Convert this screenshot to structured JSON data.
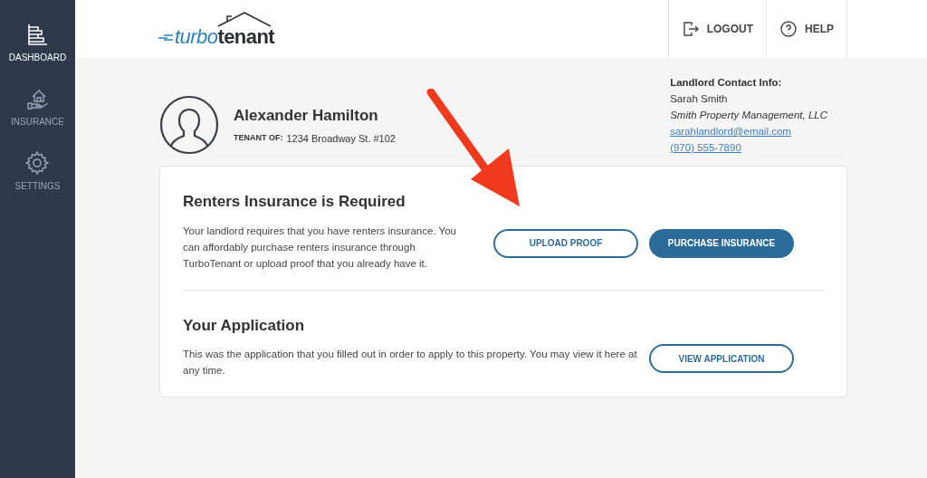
{
  "sidebar": {
    "items": [
      {
        "label": "DASHBOARD",
        "selected": true
      },
      {
        "label": "INSURANCE",
        "selected": false
      },
      {
        "label": "SETTINGS",
        "selected": false
      }
    ]
  },
  "header": {
    "logo": {
      "accent": "turbo",
      "rest": "tenant"
    },
    "actions": [
      {
        "label": "LOGOUT"
      },
      {
        "label": "HELP"
      }
    ]
  },
  "tenant": {
    "name": "Alexander Hamilton",
    "label": "TENANT OF:",
    "address": "1234 Broadway St. #102"
  },
  "landlord": {
    "heading": "Landlord Contact Info:",
    "name": "Sarah Smith",
    "company": "Smith Property Management, LLC",
    "email": "sarahlandlord@email.com",
    "phone": "(970) 555-7890"
  },
  "sections": [
    {
      "title": "Renters Insurance is Required",
      "text": "Your landlord requires that you have renters insurance. You can affordably purchase renters insurance through TurboTenant or upload proof that you already have it.",
      "buttons": [
        {
          "label": "UPLOAD PROOF",
          "kind": "outline"
        },
        {
          "label": "PURCHASE INSURANCE",
          "kind": "filled"
        }
      ]
    },
    {
      "title": "Your Application",
      "text": "This was the application that you filled out in order to apply to this property. You may view it here at any time.",
      "buttons": [
        {
          "label": "VIEW APPLICATION",
          "kind": "outline"
        }
      ]
    }
  ]
}
